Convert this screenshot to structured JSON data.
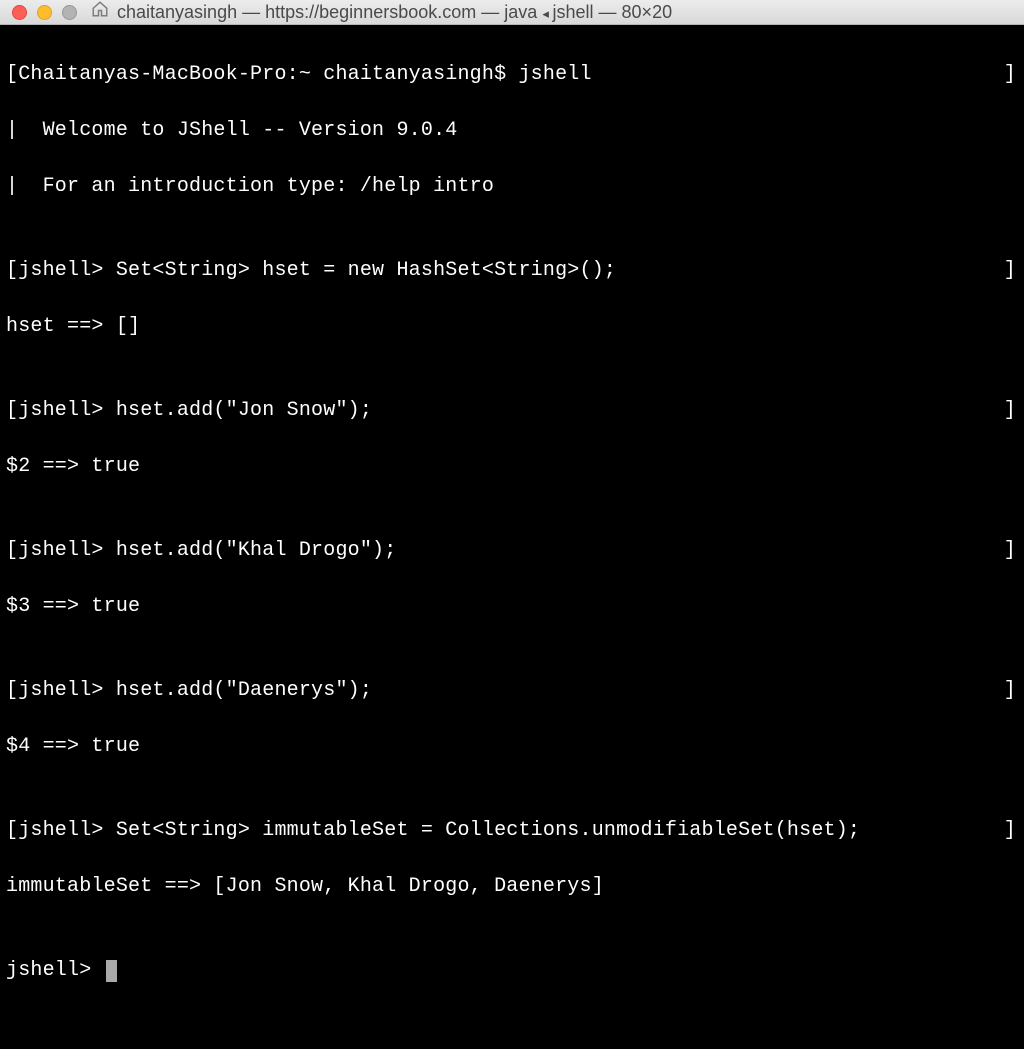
{
  "titlebar": {
    "user": "chaitanyasingh",
    "url": "https://beginnersbook.com",
    "lang": "java",
    "proc": "jshell",
    "size": "80×20"
  },
  "term": {
    "line1_left": "[Chaitanyas-MacBook-Pro:~ chaitanyasingh$ jshell",
    "line1_right": "]",
    "line2": "|  Welcome to JShell -- Version 9.0.4",
    "line3": "|  For an introduction type: /help intro",
    "blank": "",
    "line4_left": "[jshell> Set<String> hset = new HashSet<String>();",
    "line4_right": "]",
    "line5": "hset ==> []",
    "line6_left": "[jshell> hset.add(\"Jon Snow\");",
    "line6_right": "]",
    "line7": "$2 ==> true",
    "line8_left": "[jshell> hset.add(\"Khal Drogo\");",
    "line8_right": "]",
    "line9": "$3 ==> true",
    "line10_left": "[jshell> hset.add(\"Daenerys\");",
    "line10_right": "]",
    "line11": "$4 ==> true",
    "line12_left": "[jshell> Set<String> immutableSet = Collections.unmodifiableSet(hset);",
    "line12_right": "]",
    "line13": "immutableSet ==> [Jon Snow, Khal Drogo, Daenerys]",
    "prompt": "jshell> "
  }
}
